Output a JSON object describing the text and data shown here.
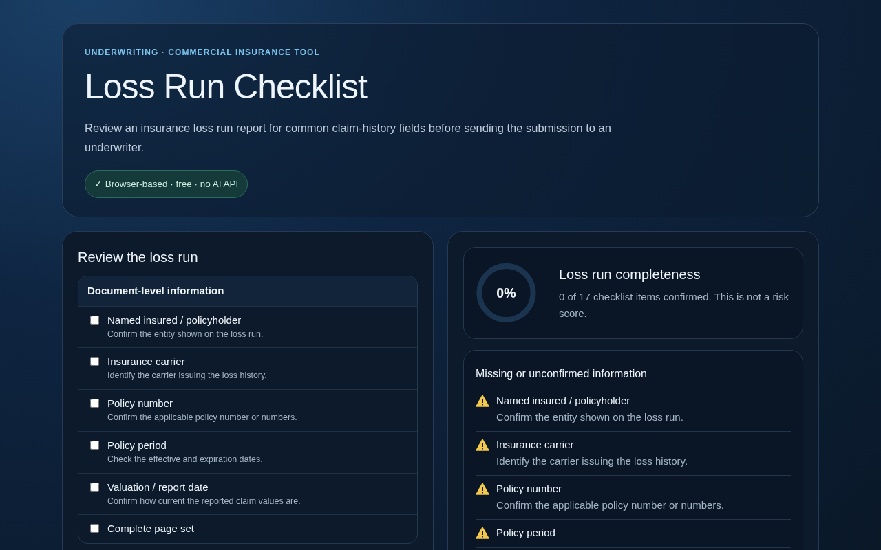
{
  "hero": {
    "eyebrow": "UNDERWRITING · COMMERCIAL INSURANCE TOOL",
    "title": "Loss Run Checklist",
    "description": "Review an insurance loss run report for common claim-history fields before sending the submission to an underwriter.",
    "badge": "✓ Browser-based · free · no AI API"
  },
  "review": {
    "title": "Review the loss run",
    "sections": [
      {
        "title": "Document-level information",
        "items": [
          {
            "label": "Named insured / policyholder",
            "hint": "Confirm the entity shown on the loss run.",
            "checked": false
          },
          {
            "label": "Insurance carrier",
            "hint": "Identify the carrier issuing the loss history.",
            "checked": false
          },
          {
            "label": "Policy number",
            "hint": "Confirm the applicable policy number or numbers.",
            "checked": false
          },
          {
            "label": "Policy period",
            "hint": "Check the effective and expiration dates.",
            "checked": false
          },
          {
            "label": "Valuation / report date",
            "hint": "Confirm how current the reported claim values are.",
            "checked": false
          },
          {
            "label": "Complete page set",
            "checked": false
          }
        ]
      }
    ]
  },
  "completeness": {
    "percent": "0%",
    "level": 0,
    "title": "Loss run completeness",
    "summary": "0 of 17 checklist items confirmed. This is not a risk score."
  },
  "missing": {
    "title": "Missing or unconfirmed information",
    "items": [
      {
        "label": "Named insured / policyholder",
        "hint": "Confirm the entity shown on the loss run."
      },
      {
        "label": "Insurance carrier",
        "hint": "Identify the carrier issuing the loss history."
      },
      {
        "label": "Policy number",
        "hint": "Confirm the applicable policy number or numbers."
      },
      {
        "label": "Policy period"
      }
    ]
  }
}
